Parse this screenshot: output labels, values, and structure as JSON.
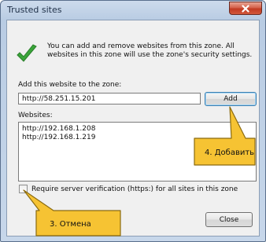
{
  "window": {
    "title": "Trusted sites"
  },
  "info_text": "You can add and remove websites from this zone. All websites in this zone will use the zone's security settings.",
  "add_label": "Add this website to the zone:",
  "website_input_value": "http://58.251.15.201",
  "add_button": "Add",
  "websites_label": "Websites:",
  "websites": [
    "http://192.168.1.208",
    "http://192.168.1.219"
  ],
  "verify_label": "Require server verification (https:) for all sites in this zone",
  "verify_checked": false,
  "close_button": "Close",
  "annotations": {
    "add_note": "4. Добавить",
    "cancel_note": "3. Отмена"
  },
  "colors": {
    "callout_fill": "#f6c333",
    "callout_stroke": "#8a6a10",
    "check_green": "#3aa53a"
  }
}
